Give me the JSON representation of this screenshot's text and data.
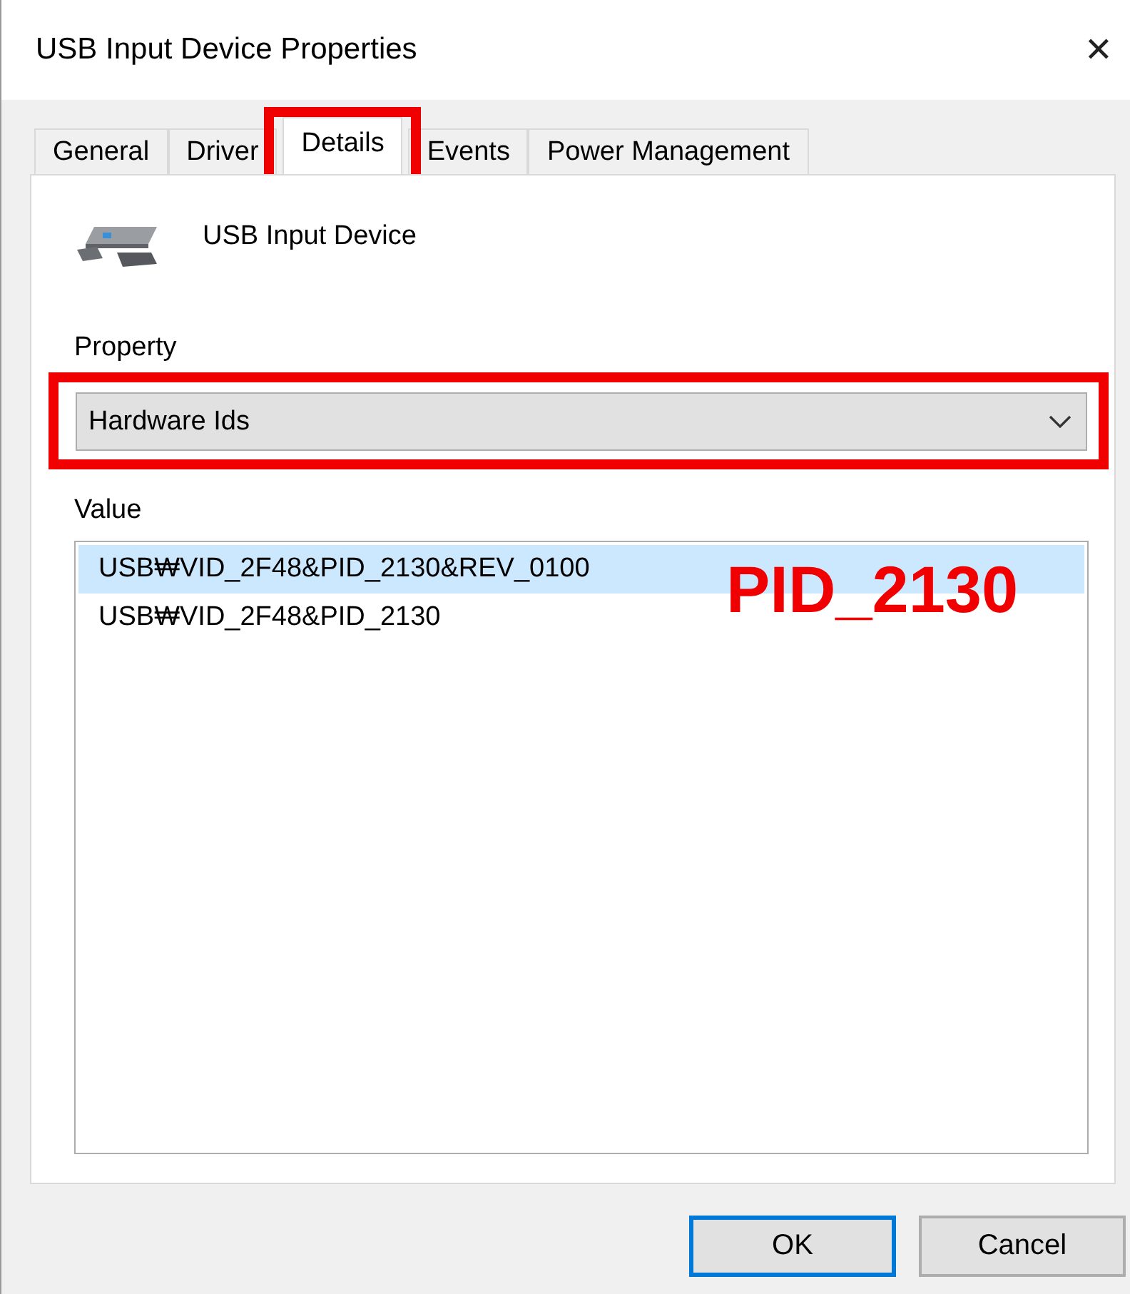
{
  "window": {
    "title": "USB Input Device Properties",
    "close": "✕"
  },
  "tabs": [
    {
      "label": "General",
      "selected": false,
      "highlighted": false
    },
    {
      "label": "Driver",
      "selected": false,
      "highlighted": false
    },
    {
      "label": "Details",
      "selected": true,
      "highlighted": true
    },
    {
      "label": "Events",
      "selected": false,
      "highlighted": false
    },
    {
      "label": "Power Management",
      "selected": false,
      "highlighted": false
    }
  ],
  "device": {
    "name": "USB Input Device"
  },
  "property": {
    "label": "Property",
    "value": "Hardware Ids",
    "highlighted": true
  },
  "value_list": {
    "label": "Value",
    "rows": [
      {
        "text": "USB₩VID_2F48&PID_2130&REV_0100",
        "selected": true
      },
      {
        "text": "USB₩VID_2F48&PID_2130",
        "selected": false
      }
    ]
  },
  "annotation": {
    "text": "PID_2130"
  },
  "buttons": [
    {
      "label": "OK",
      "default": true
    },
    {
      "label": "Cancel",
      "default": false
    }
  ]
}
